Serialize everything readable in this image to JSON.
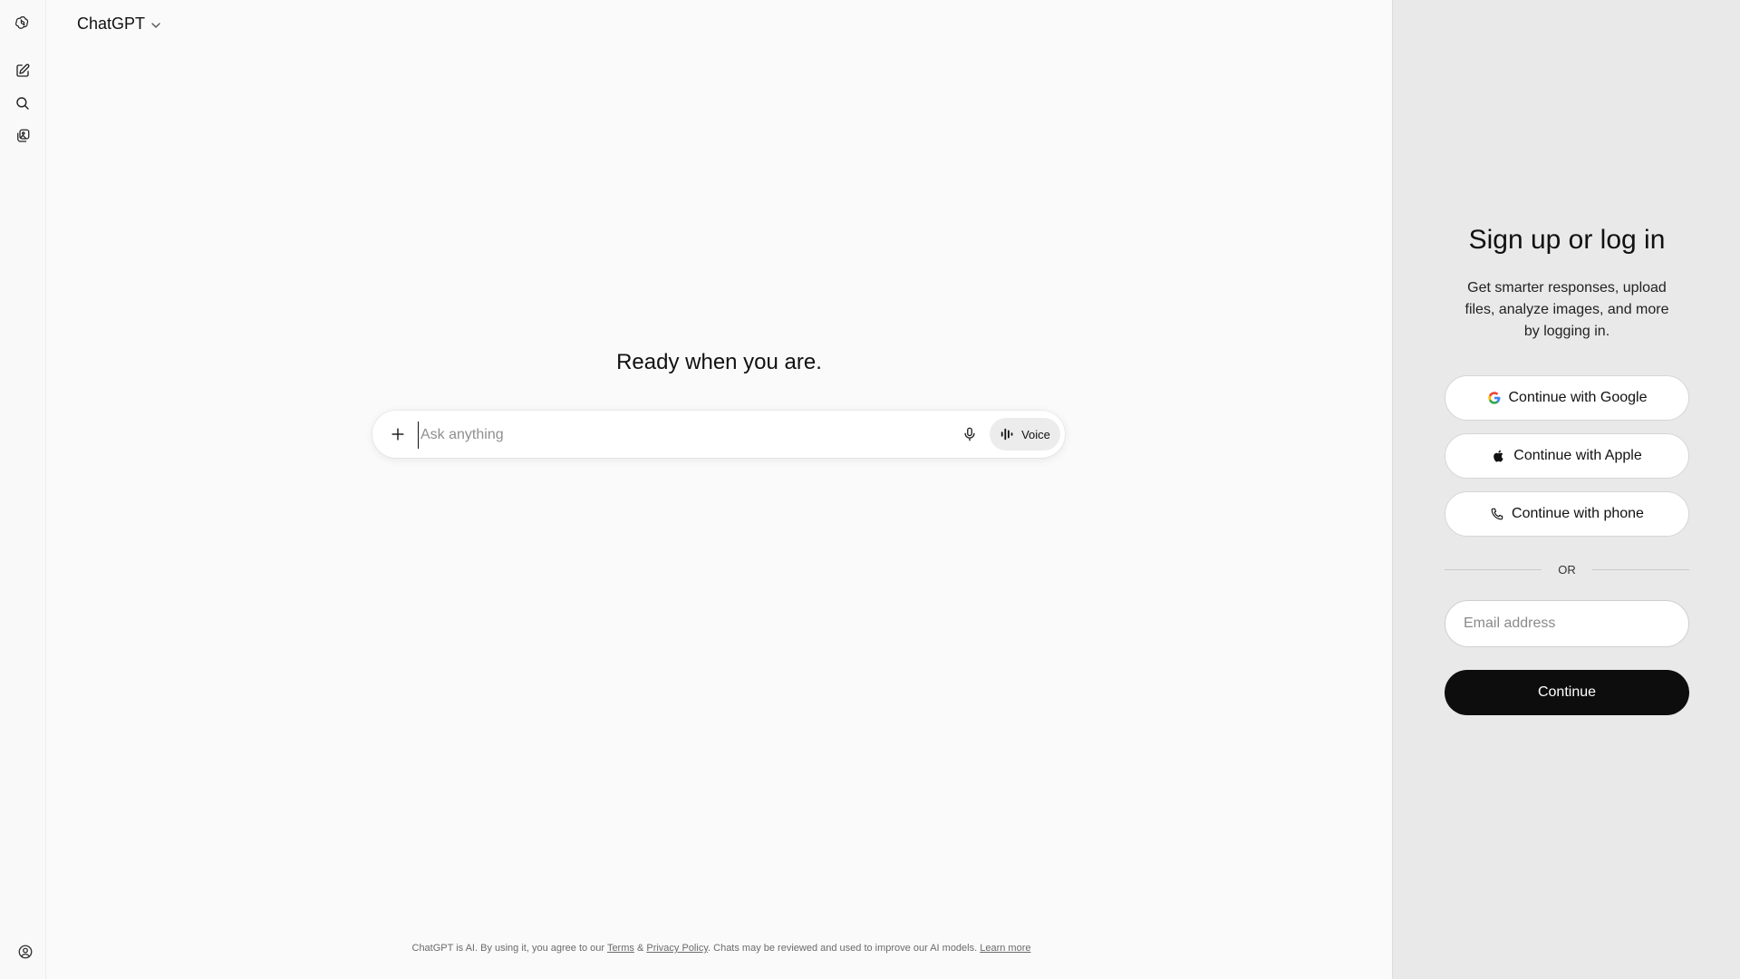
{
  "app": {
    "model_name": "ChatGPT"
  },
  "rail": {
    "icons": [
      "openai-logo-icon",
      "new-chat-icon",
      "search-icon",
      "images-icon"
    ],
    "bottom_icon": "help-icon"
  },
  "main": {
    "headline": "Ready when you are.",
    "composer": {
      "placeholder": "Ask anything",
      "value": "",
      "voice_label": "Voice"
    },
    "footer": {
      "prefix": "ChatGPT is AI. By using it, you agree to our",
      "terms": "Terms",
      "and": "&",
      "privacy": "Privacy Policy",
      "middle": ". Chats may be reviewed and used to improve our AI models.",
      "learn_more": "Learn more"
    }
  },
  "auth": {
    "title": "Sign up or log in",
    "subtitle": "Get smarter responses, upload files, analyze images, and more by logging in.",
    "google_label": "Continue with Google",
    "apple_label": "Continue with Apple",
    "phone_label": "Continue with phone",
    "or_label": "OR",
    "email_placeholder": "Email address",
    "email_value": "",
    "continue_label": "Continue"
  },
  "colors": {
    "background": "#fafafa",
    "panel_background": "#e9e9e9",
    "primary_button": "#0d0d0d",
    "text": "#0d0d0d"
  }
}
